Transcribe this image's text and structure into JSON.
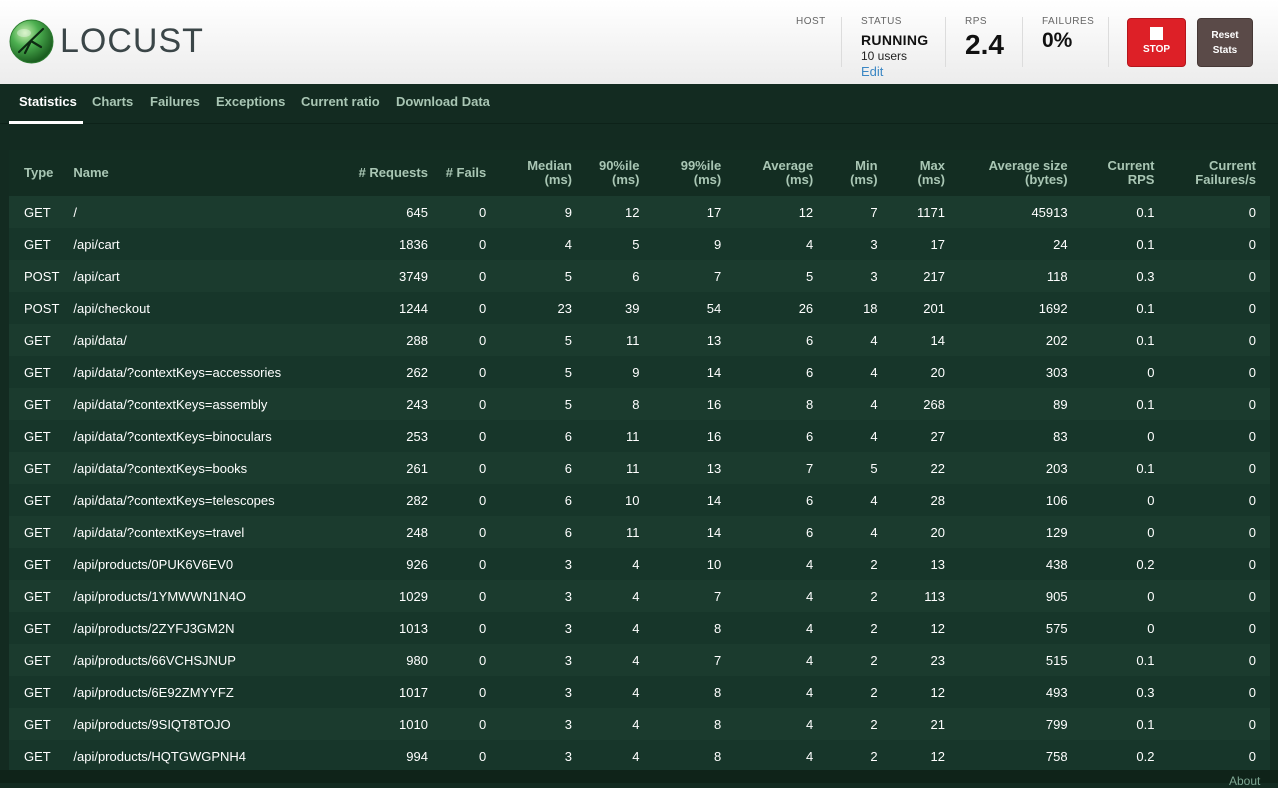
{
  "app": {
    "name": "LOCUST",
    "logo_icon": "locust-logo-icon"
  },
  "header": {
    "host_label": "HOST",
    "status_label": "STATUS",
    "status_value": "RUNNING",
    "users_text": "10 users",
    "edit_label": "Edit",
    "rps_label": "RPS",
    "rps_value": "2.4",
    "failures_label": "FAILURES",
    "failures_value": "0%",
    "stop_label": "STOP",
    "reset_label_1": "Reset",
    "reset_label_2": "Stats",
    "stop_color": "#dd2027"
  },
  "tabs": [
    {
      "label": "Statistics",
      "active": true
    },
    {
      "label": "Charts",
      "active": false
    },
    {
      "label": "Failures",
      "active": false
    },
    {
      "label": "Exceptions",
      "active": false
    },
    {
      "label": "Current ratio",
      "active": false
    },
    {
      "label": "Download Data",
      "active": false
    }
  ],
  "table": {
    "headers": {
      "type": "Type",
      "name": "Name",
      "requests": "# Requests",
      "fails": "# Fails",
      "median_1": "Median",
      "median_2": "(ms)",
      "p90_1": "90%ile",
      "p90_2": "(ms)",
      "p99_1": "99%ile",
      "p99_2": "(ms)",
      "avg_1": "Average",
      "avg_2": "(ms)",
      "min_1": "Min",
      "min_2": "(ms)",
      "max_1": "Max",
      "max_2": "(ms)",
      "size_1": "Average size",
      "size_2": "(bytes)",
      "rps_1": "Current",
      "rps_2": "RPS",
      "fps_1": "Current",
      "fps_2": "Failures/s"
    },
    "rows": [
      [
        "GET",
        "/",
        "645",
        "0",
        "9",
        "12",
        "17",
        "12",
        "7",
        "1171",
        "45913",
        "0.1",
        "0"
      ],
      [
        "GET",
        "/api/cart",
        "1836",
        "0",
        "4",
        "5",
        "9",
        "4",
        "3",
        "17",
        "24",
        "0.1",
        "0"
      ],
      [
        "POST",
        "/api/cart",
        "3749",
        "0",
        "5",
        "6",
        "7",
        "5",
        "3",
        "217",
        "118",
        "0.3",
        "0"
      ],
      [
        "POST",
        "/api/checkout",
        "1244",
        "0",
        "23",
        "39",
        "54",
        "26",
        "18",
        "201",
        "1692",
        "0.1",
        "0"
      ],
      [
        "GET",
        "/api/data/",
        "288",
        "0",
        "5",
        "11",
        "13",
        "6",
        "4",
        "14",
        "202",
        "0.1",
        "0"
      ],
      [
        "GET",
        "/api/data/?contextKeys=accessories",
        "262",
        "0",
        "5",
        "9",
        "14",
        "6",
        "4",
        "20",
        "303",
        "0",
        "0"
      ],
      [
        "GET",
        "/api/data/?contextKeys=assembly",
        "243",
        "0",
        "5",
        "8",
        "16",
        "8",
        "4",
        "268",
        "89",
        "0.1",
        "0"
      ],
      [
        "GET",
        "/api/data/?contextKeys=binoculars",
        "253",
        "0",
        "6",
        "11",
        "16",
        "6",
        "4",
        "27",
        "83",
        "0",
        "0"
      ],
      [
        "GET",
        "/api/data/?contextKeys=books",
        "261",
        "0",
        "6",
        "11",
        "13",
        "7",
        "5",
        "22",
        "203",
        "0.1",
        "0"
      ],
      [
        "GET",
        "/api/data/?contextKeys=telescopes",
        "282",
        "0",
        "6",
        "10",
        "14",
        "6",
        "4",
        "28",
        "106",
        "0",
        "0"
      ],
      [
        "GET",
        "/api/data/?contextKeys=travel",
        "248",
        "0",
        "6",
        "11",
        "14",
        "6",
        "4",
        "20",
        "129",
        "0",
        "0"
      ],
      [
        "GET",
        "/api/products/0PUK6V6EV0",
        "926",
        "0",
        "3",
        "4",
        "10",
        "4",
        "2",
        "13",
        "438",
        "0.2",
        "0"
      ],
      [
        "GET",
        "/api/products/1YMWWN1N4O",
        "1029",
        "0",
        "3",
        "4",
        "7",
        "4",
        "2",
        "113",
        "905",
        "0",
        "0"
      ],
      [
        "GET",
        "/api/products/2ZYFJ3GM2N",
        "1013",
        "0",
        "3",
        "4",
        "8",
        "4",
        "2",
        "12",
        "575",
        "0",
        "0"
      ],
      [
        "GET",
        "/api/products/66VCHSJNUP",
        "980",
        "0",
        "3",
        "4",
        "7",
        "4",
        "2",
        "23",
        "515",
        "0.1",
        "0"
      ],
      [
        "GET",
        "/api/products/6E92ZMYYFZ",
        "1017",
        "0",
        "3",
        "4",
        "8",
        "4",
        "2",
        "12",
        "493",
        "0.3",
        "0"
      ],
      [
        "GET",
        "/api/products/9SIQT8TOJO",
        "1010",
        "0",
        "3",
        "4",
        "8",
        "4",
        "2",
        "21",
        "799",
        "0.1",
        "0"
      ],
      [
        "GET",
        "/api/products/HQTGWGPNH4",
        "994",
        "0",
        "3",
        "4",
        "8",
        "4",
        "2",
        "12",
        "758",
        "0.2",
        "0"
      ]
    ]
  },
  "footer": {
    "about_label": "About"
  }
}
